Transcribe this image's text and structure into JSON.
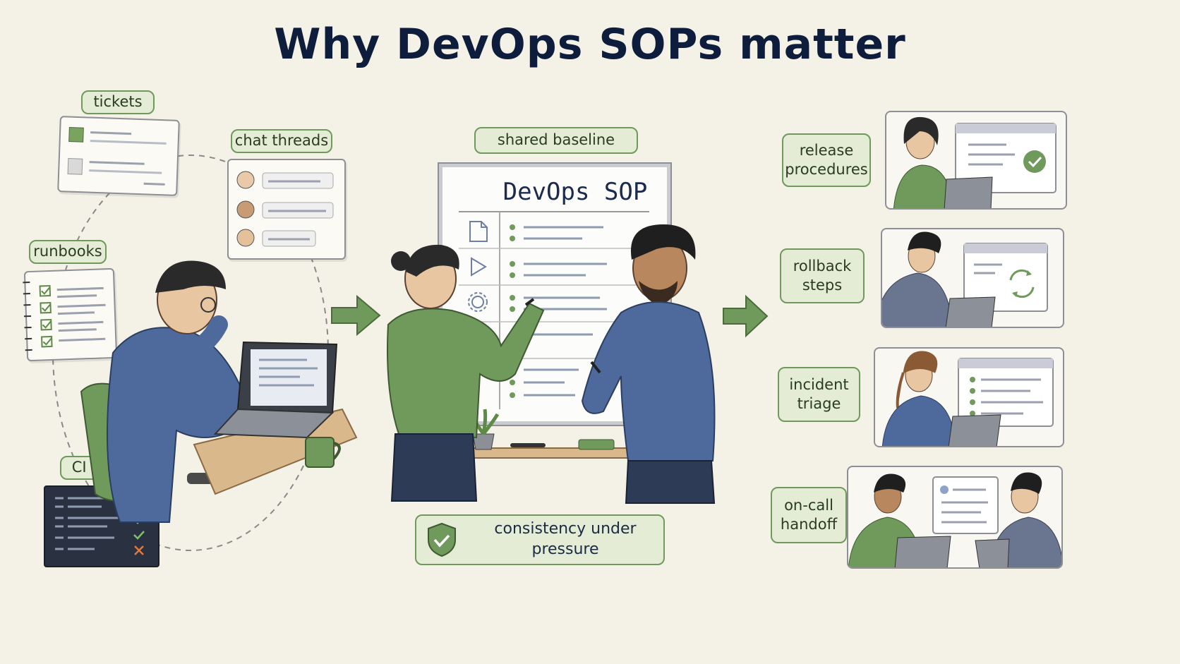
{
  "title": "Why DevOps SOPs matter",
  "left": {
    "tickets_label": "tickets",
    "chat_threads_label": "chat threads",
    "runbooks_label": "runbooks",
    "ci_logs_label": "CI logs"
  },
  "center": {
    "shared_baseline_label": "shared baseline",
    "board_title": "DevOps SOP",
    "consistency_label": "consistency under pressure"
  },
  "right": {
    "items": [
      {
        "label_line1": "release",
        "label_line2": "procedures"
      },
      {
        "label_line1": "rollback",
        "label_line2": "steps"
      },
      {
        "label_line1": "incident",
        "label_line2": "triage"
      },
      {
        "label_line1": "on-call",
        "label_line2": "handoff"
      }
    ]
  },
  "colors": {
    "background": "#f4f1e7",
    "accent_green": "#6f9a5b",
    "navy": "#0f1d3d",
    "shirt_blue": "#4e6a9c"
  },
  "icons": [
    "document-icon",
    "play-icon",
    "gear-icon",
    "shield-icon",
    "checkmark-icon",
    "refresh-icon",
    "arrow-right-icon",
    "user-icon"
  ]
}
